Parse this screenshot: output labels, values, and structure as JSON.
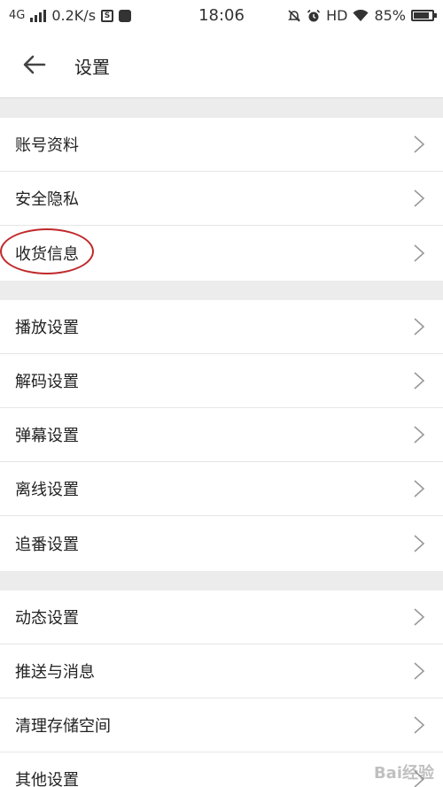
{
  "status_bar": {
    "network": "4G",
    "speed": "0.2K/s",
    "time": "18:06",
    "hd": "HD",
    "battery": "85%",
    "battery_level": 0.85,
    "icons": [
      "signal-icon",
      "s-icon",
      "app-icon",
      "bell-off-icon",
      "alarm-icon",
      "wifi-icon",
      "battery-icon"
    ]
  },
  "header": {
    "title": "设置"
  },
  "sections": [
    {
      "items": [
        "账号资料",
        "安全隐私",
        "收货信息"
      ]
    },
    {
      "items": [
        "播放设置",
        "解码设置",
        "弹幕设置",
        "离线设置",
        "追番设置"
      ]
    },
    {
      "items": [
        "动态设置",
        "推送与消息",
        "清理存储空间",
        "其他设置"
      ]
    }
  ],
  "annotation_color": "#c0292b",
  "watermark": "Bai经验"
}
